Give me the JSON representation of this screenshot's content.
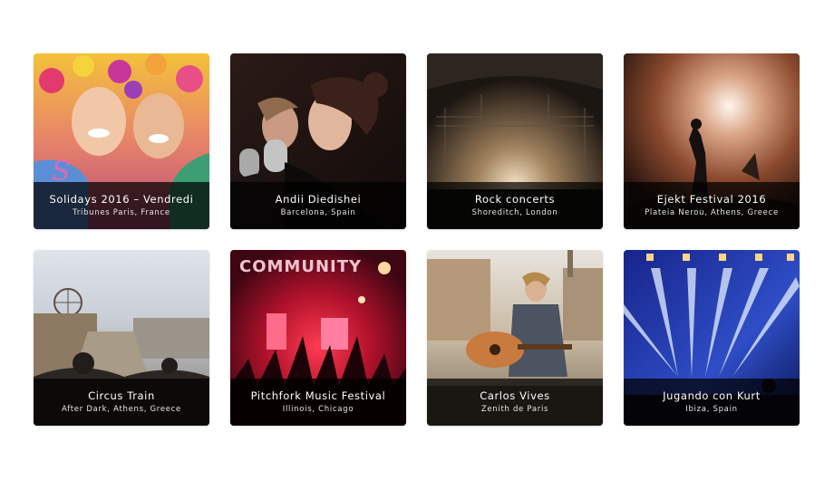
{
  "events": [
    {
      "title": "Solidays 2016 – Vendredi",
      "subtitle": "Tribunes Paris, France",
      "image": "festival-girls-flower-crowns"
    },
    {
      "title": "Andii Diedishei",
      "subtitle": "Barcelona, Spain",
      "image": "singers-vintage-microphones"
    },
    {
      "title": "Rock concerts",
      "subtitle": "Shoreditch, London",
      "image": "concert-stage-lights"
    },
    {
      "title": "Ejekt Festival 2016",
      "subtitle": "Plateia Nerou, Athens, Greece",
      "image": "crowd-raised-hand"
    },
    {
      "title": "Circus Train",
      "subtitle": "After Dark, Athens, Greece",
      "image": "boardwalk-ferris-wheel"
    },
    {
      "title": "Pitchfork Music Festival",
      "subtitle": "Illinois, Chicago",
      "image": "community-stage-red-lights"
    },
    {
      "title": "Carlos Vives",
      "subtitle": "Zenith de Paris",
      "image": "street-guitarist"
    },
    {
      "title": "Jugando con Kurt",
      "subtitle": "Ibiza, Spain",
      "image": "blue-light-beams-stage"
    }
  ]
}
